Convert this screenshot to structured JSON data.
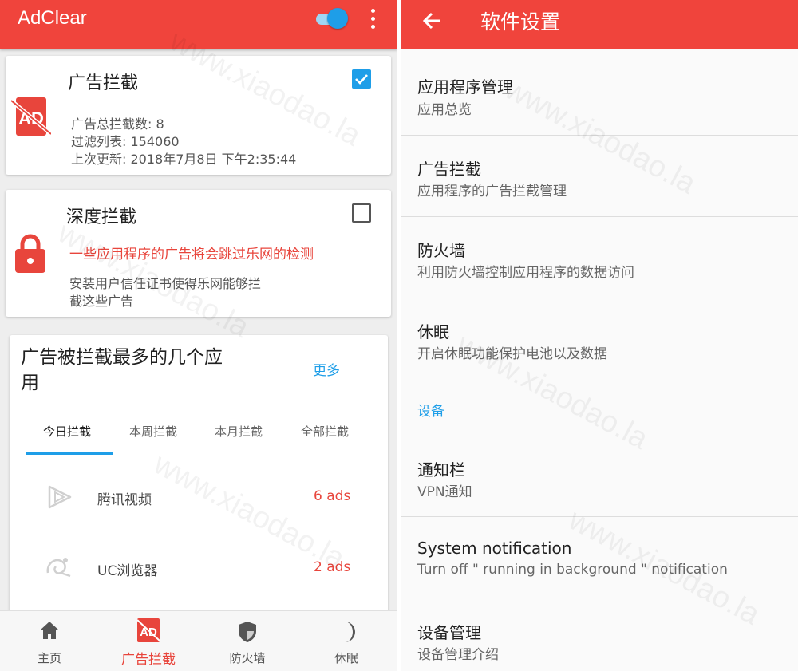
{
  "left": {
    "appbar": {
      "title": "AdClear",
      "menu_icon": "more-vert-icon"
    },
    "ad_block_card": {
      "title": "广告拦截",
      "stats": [
        "广告总拦截数: 8",
        "过滤列表: 154060",
        "上次更新: 2018年7月8日  下午2:35:44"
      ],
      "checked": true
    },
    "deep_block_card": {
      "title": "深度拦截",
      "warning": "一些应用程序的广告将会跳过乐网的检测",
      "desc_line1": "安装用户信任证书使得乐网能够拦",
      "desc_line2": "截这些广告",
      "checked": false
    },
    "top_apps_card": {
      "title": "广告被拦截最多的几个应用",
      "more": "更多",
      "tabs": [
        {
          "label": "今日拦截",
          "active": true
        },
        {
          "label": "本周拦截",
          "active": false
        },
        {
          "label": "本月拦截",
          "active": false
        },
        {
          "label": "全部拦截",
          "active": false
        }
      ],
      "rows": [
        {
          "name": "腾讯视频",
          "ads": "6 ads"
        },
        {
          "name": "UC浏览器",
          "ads": "2 ads"
        }
      ]
    },
    "bottom_nav": [
      {
        "label": "主页",
        "icon": "home-icon",
        "active": false
      },
      {
        "label": "广告拦截",
        "icon": "ad-block-icon",
        "active": true
      },
      {
        "label": "防火墙",
        "icon": "shield-icon",
        "active": false
      },
      {
        "label": "休眠",
        "icon": "moon-icon",
        "active": false
      }
    ]
  },
  "right": {
    "appbar": {
      "title": "软件设置",
      "back_icon": "arrow-back-icon"
    },
    "items": [
      {
        "title": "应用程序管理",
        "subtitle": "应用总览"
      },
      {
        "title": "广告拦截",
        "subtitle": "应用程序的广告拦截管理"
      },
      {
        "title": "防火墙",
        "subtitle": "利用防火墙控制应用程序的数据访问"
      },
      {
        "title": "休眠",
        "subtitle": "开启休眠功能保护电池以及数据"
      }
    ],
    "section": "设备",
    "device_items": [
      {
        "title": "通知栏",
        "subtitle": "VPN通知"
      },
      {
        "title": "System notification",
        "subtitle": "Turn off \" running in background \" notification"
      },
      {
        "title": "设备管理",
        "subtitle": "设备管理介绍"
      }
    ]
  },
  "watermark": "www.xiaodao.la",
  "colors": {
    "primary": "#f0443c",
    "accent": "#1e9ee8",
    "warning": "#e8453c"
  }
}
